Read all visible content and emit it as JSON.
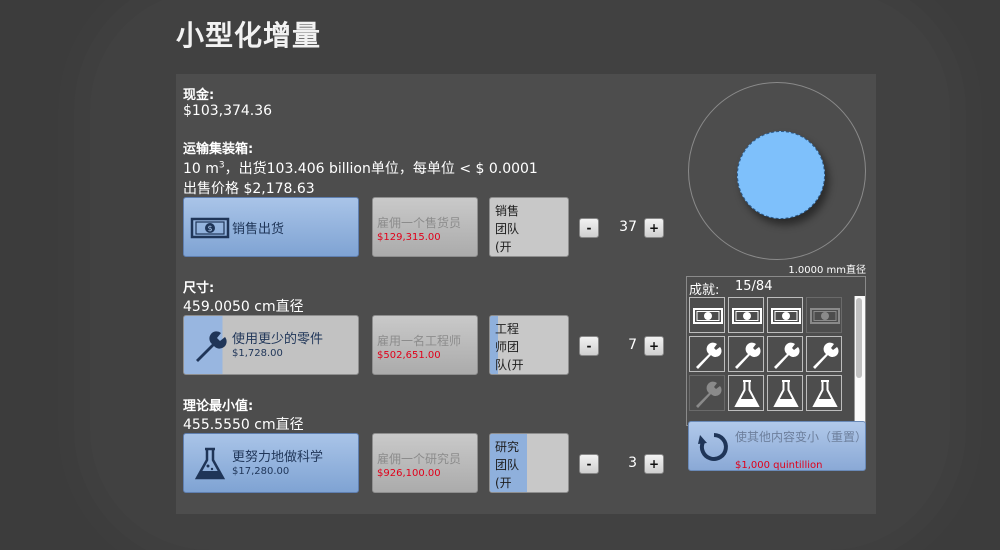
{
  "page": {
    "title": "小型化增量"
  },
  "cash": {
    "label": "现金:",
    "value": "$103,374.36"
  },
  "container": {
    "label": "运输集装箱:",
    "volume_prefix": "10 m",
    "volume_exp": "3",
    "shipment_text": "，出货103.406 billion单位，每单位 < $ 0.0001",
    "price_text": "出售价格 $2,178.63"
  },
  "sales_row": {
    "main_button": {
      "label": "销售出货",
      "icon": "money-icon"
    },
    "hire_button": {
      "label": "雇佣一个售货员",
      "price": "$129,315.00"
    },
    "team_button": {
      "label": "销售团队(开启)",
      "progress": 0
    },
    "minus_label": "-",
    "plus_label": "+",
    "count": "37"
  },
  "size": {
    "label": "尺寸:",
    "value": "459.0050 cm直径"
  },
  "engineer_row": {
    "main_button": {
      "label": "使用更少的零件",
      "price": "$1,728.00",
      "icon": "wrench-icon"
    },
    "hire_button": {
      "label": "雇用一名工程师",
      "price": "$502,651.00"
    },
    "team_button": {
      "label": "工程师团队(开启)",
      "progress": 0.1
    },
    "minus_label": "-",
    "plus_label": "+",
    "count": "7"
  },
  "theoretical_min": {
    "label": "理论最小值:",
    "value": "455.5550 cm直径"
  },
  "research_row": {
    "main_button": {
      "label": "更努力地做科学",
      "price": "$17,280.00",
      "icon": "flask-icon"
    },
    "hire_button": {
      "label": "雇佣一个研究员",
      "price": "$926,100.00"
    },
    "team_button": {
      "label": "研究团队(开启)",
      "progress": 0.48
    },
    "minus_label": "-",
    "plus_label": "+",
    "count": "3"
  },
  "object": {
    "diameter_label": "1.0000 mm直径",
    "color": "#7ec0fb"
  },
  "achievements": {
    "title": "成就:",
    "count": "15/84",
    "rows": [
      [
        "money-icon",
        "money-icon",
        "money-icon",
        "money-icon-locked"
      ],
      [
        "wrench-icon",
        "wrench-icon",
        "wrench-icon",
        "wrench-icon"
      ],
      [
        "wrench-icon-locked",
        "flask-icon",
        "flask-icon",
        "flask-icon"
      ]
    ]
  },
  "reset_button": {
    "label": "使其他内容变小（重置）",
    "price": "$1,000 quintillion",
    "icon": "reset-icon"
  },
  "colors": {
    "accent": "#8fb0dc",
    "price_red": "#e0001a",
    "panel": "#4d4d4d"
  }
}
